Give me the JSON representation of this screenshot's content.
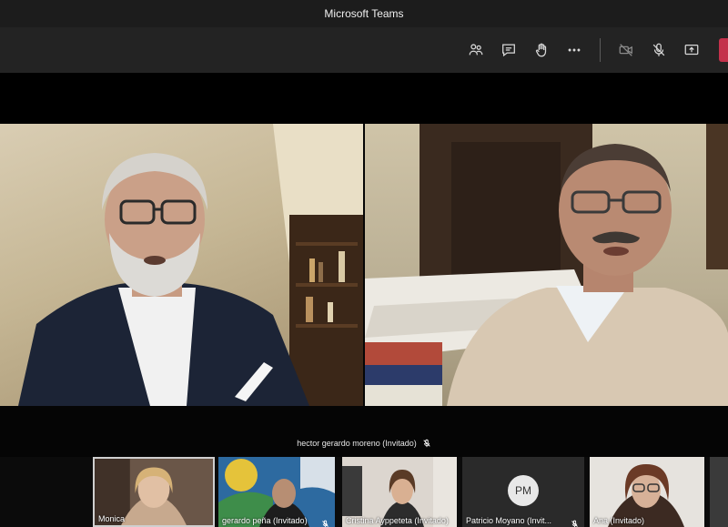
{
  "window": {
    "title": "Microsoft Teams"
  },
  "toolbar": {
    "buttons": [
      {
        "name": "participants",
        "icon": "people-icon"
      },
      {
        "name": "chat",
        "icon": "chat-icon"
      },
      {
        "name": "raise-hand",
        "icon": "hand-icon"
      },
      {
        "name": "more",
        "icon": "more-icon"
      },
      {
        "name": "camera",
        "icon": "camera-off-icon"
      },
      {
        "name": "mic",
        "icon": "mic-off-icon"
      },
      {
        "name": "share",
        "icon": "share-icon"
      }
    ],
    "leave_color": "#c4314b"
  },
  "speaker": {
    "label": "hector gerardo moreno (Invitado)"
  },
  "gallery": [
    {
      "label": "Monica",
      "type": "video"
    },
    {
      "label": "gerardo peña (Invitado)",
      "type": "video"
    },
    {
      "label": "Cristina Ayppeteta (Invitado)",
      "type": "video"
    },
    {
      "label": "Patricio Moyano (Invit...",
      "type": "avatar",
      "initials": "PM"
    },
    {
      "label": "Ana (Invitado)",
      "type": "video"
    }
  ]
}
